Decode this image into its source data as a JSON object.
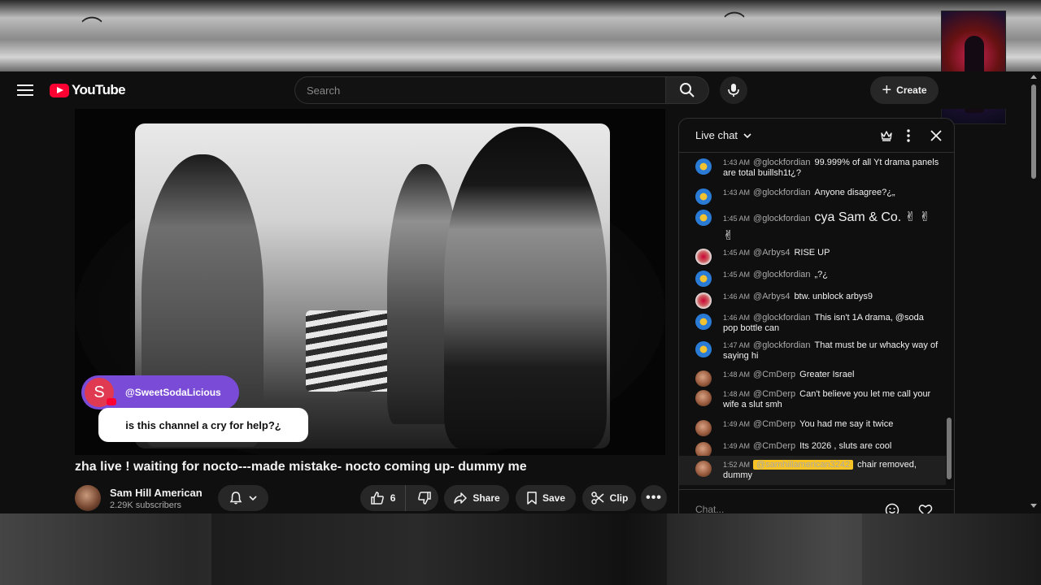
{
  "masthead": {
    "logo_text": "YouTube",
    "search_placeholder": "Search",
    "create_label": "Create"
  },
  "overlay": {
    "avatar_letter": "S",
    "name": "@SweetSodaLicious",
    "message": "is this channel a cry for help?¿"
  },
  "video": {
    "title": "zha live ! waiting for nocto---made mistake- nocto coming up- dummy me",
    "channel_name": "Sam Hill American",
    "subscribers": "2.29K subscribers",
    "like_count": "6",
    "share_label": "Share",
    "save_label": "Save",
    "clip_label": "Clip"
  },
  "chat": {
    "title": "Live chat",
    "input_placeholder": "Chat...",
    "messages": [
      {
        "time": "1:43 AM",
        "author": "@glockfordian",
        "text": "99.999% of all Yt drama panels are total buillsh1t¿?"
      },
      {
        "time": "1:43 AM",
        "author": "@glockfordian",
        "text": "Anyone disagree?¿„"
      },
      {
        "time": "1:45 AM",
        "author": "@glockfordian",
        "text": "cya Sam & Co. ✌ ✌ ✌"
      },
      {
        "time": "1:45 AM",
        "author": "@Arbys4",
        "text": "RISE UP"
      },
      {
        "time": "1:45 AM",
        "author": "@glockfordian",
        "text": "„?¿"
      },
      {
        "time": "1:46 AM",
        "author": "@Arbys4",
        "text": "btw. unblock arbys9"
      },
      {
        "time": "1:46 AM",
        "author": "@glockfordian",
        "text": "This isn't 1A drama, @soda pop bottle can"
      },
      {
        "time": "1:47 AM",
        "author": "@glockfordian",
        "text": "That must be ur whacky way of saying hi"
      },
      {
        "time": "1:48 AM",
        "author": "@CmDerp",
        "text": "Greater Israel"
      },
      {
        "time": "1:48 AM",
        "author": "@CmDerp",
        "text": "Can't believe you let me call your wife a slut smh"
      },
      {
        "time": "1:49 AM",
        "author": "@CmDerp",
        "text": "You had me say it twice"
      },
      {
        "time": "1:49 AM",
        "author": "@CmDerp",
        "text": "Its 2026 , sluts are cool"
      },
      {
        "time": "1:52 AM",
        "author": "@samhillamerican3242",
        "text": "chair removed, dummy"
      }
    ]
  },
  "colors": {
    "accent_red": "#ff0033",
    "mention_yellow": "#f7c325",
    "overlay_purple": "#7a4bd6"
  }
}
